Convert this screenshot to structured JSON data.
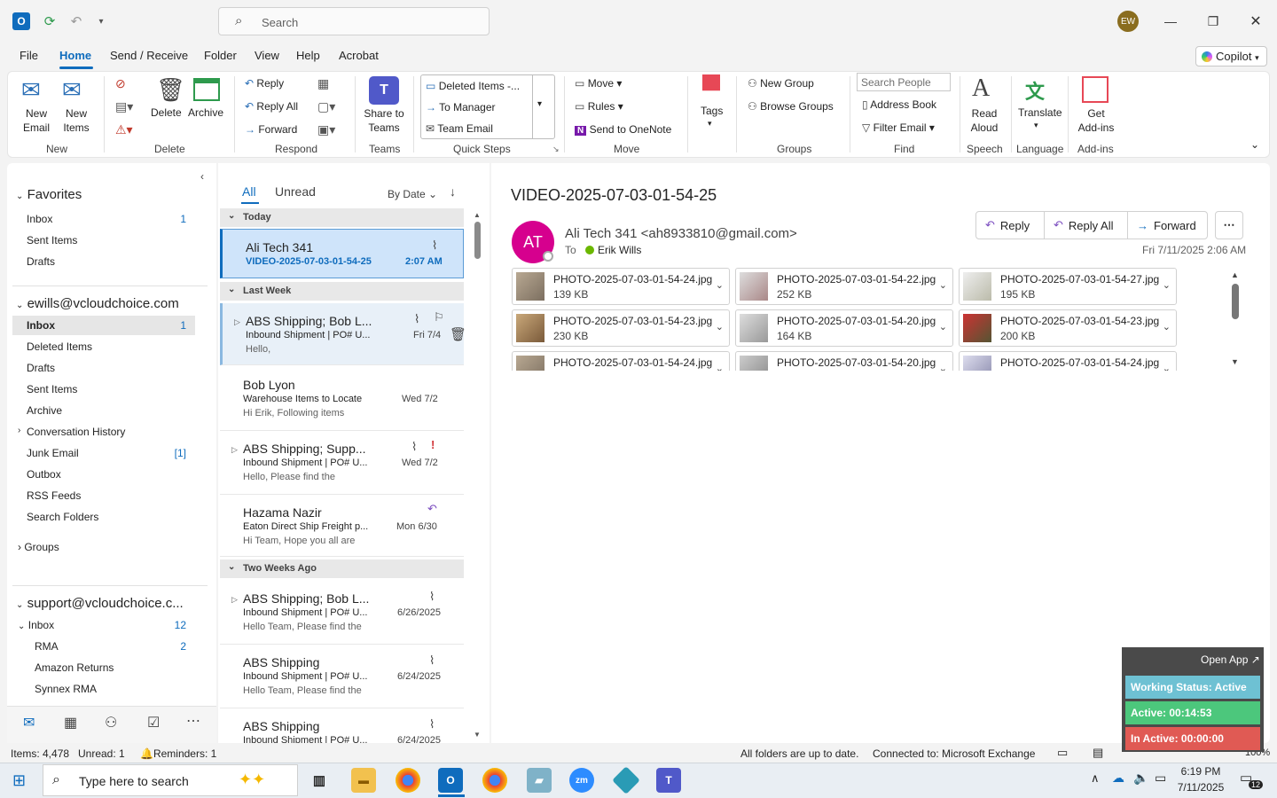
{
  "titlebar": {
    "search_placeholder": "Search",
    "avatar_initials": "EW"
  },
  "menu": [
    "File",
    "Home",
    "Send / Receive",
    "Folder",
    "View",
    "Help",
    "Acrobat"
  ],
  "copilot_label": "Copilot",
  "ribbon": {
    "new_email": "New Email",
    "new_items": "New Items",
    "group_new": "New",
    "delete": "Delete",
    "archive": "Archive",
    "group_delete": "Delete",
    "reply": "Reply",
    "reply_all": "Reply All",
    "forward": "Forward",
    "group_respond": "Respond",
    "share_to_teams": "Share to Teams",
    "group_teams": "Teams",
    "qs_deleted": "Deleted Items -...",
    "qs_manager": "To Manager",
    "qs_team_email": "Team Email",
    "group_quicksteps": "Quick Steps",
    "move": "Move",
    "rules": "Rules",
    "send_onenote": "Send to OneNote",
    "group_move": "Move",
    "tags": "Tags",
    "new_group": "New Group",
    "browse_groups": "Browse Groups",
    "group_groups": "Groups",
    "search_people": "Search People",
    "address_book": "Address Book",
    "filter_email": "Filter Email",
    "group_find": "Find",
    "read_aloud": "Read Aloud",
    "group_speech": "Speech",
    "translate": "Translate",
    "group_language": "Language",
    "get_addins": "Get Add-ins",
    "group_addins": "Add-ins"
  },
  "nav": {
    "favorites": "Favorites",
    "fav_items": [
      {
        "label": "Inbox",
        "count": "1"
      },
      {
        "label": "Sent Items",
        "count": ""
      },
      {
        "label": "Drafts",
        "count": ""
      }
    ],
    "account1": "ewills@vcloudchoice.com",
    "acc1_items": [
      {
        "label": "Inbox",
        "count": "1"
      },
      {
        "label": "Deleted Items",
        "count": ""
      },
      {
        "label": "Drafts",
        "count": ""
      },
      {
        "label": "Sent Items",
        "count": ""
      },
      {
        "label": "Archive",
        "count": ""
      },
      {
        "label": "Conversation History",
        "count": ""
      },
      {
        "label": "Junk Email",
        "count": "[1]"
      },
      {
        "label": "Outbox",
        "count": ""
      },
      {
        "label": "RSS Feeds",
        "count": ""
      },
      {
        "label": "Search Folders",
        "count": ""
      }
    ],
    "groups": "Groups",
    "account2": "support@vcloudchoice.c...",
    "acc2_items": [
      {
        "label": "Inbox",
        "count": "12"
      },
      {
        "label": "RMA",
        "count": "2"
      },
      {
        "label": "Amazon Returns",
        "count": ""
      },
      {
        "label": "Synnex RMA",
        "count": ""
      }
    ]
  },
  "list": {
    "tab_all": "All",
    "tab_unread": "Unread",
    "sort": "By Date",
    "groups": {
      "today": "Today",
      "last_week": "Last Week",
      "two_weeks": "Two Weeks Ago"
    },
    "messages": [
      {
        "sender": "Ali Tech 341",
        "subject": "VIDEO-2025-07-03-01-54-25",
        "preview": "",
        "date": "2:07 AM"
      },
      {
        "sender": "ABS Shipping;  Bob L...",
        "subject": "Inbound Shipment | PO# U...",
        "preview": "Hello,",
        "date": "Fri 7/4"
      },
      {
        "sender": "Bob Lyon",
        "subject": "Warehouse Items to Locate",
        "preview": "Hi Erik,  Following items",
        "date": "Wed 7/2"
      },
      {
        "sender": "ABS Shipping;  Supp...",
        "subject": "Inbound Shipment | PO# U...",
        "preview": "Hello,  Please find the",
        "date": "Wed 7/2"
      },
      {
        "sender": "Hazama Nazir",
        "subject": "Eaton Direct Ship Freight p...",
        "preview": "Hi Team,  Hope you all are",
        "date": "Mon 6/30"
      },
      {
        "sender": "ABS Shipping;  Bob L...",
        "subject": "Inbound Shipment | PO# U...",
        "preview": "Hello Team,  Please find the",
        "date": "6/26/2025"
      },
      {
        "sender": "ABS Shipping",
        "subject": "Inbound Shipment | PO# U...",
        "preview": "Hello Team,  Please find the",
        "date": "6/24/2025"
      },
      {
        "sender": "ABS Shipping",
        "subject": "Inbound Shipment | PO# U...",
        "preview": "",
        "date": "6/24/2025"
      }
    ]
  },
  "reading": {
    "subject": "VIDEO-2025-07-03-01-54-25",
    "avatar": "AT",
    "from": "Ali Tech 341 <ah8933810@gmail.com>",
    "to_label": "To",
    "to_name": "Erik Wills",
    "date": "Fri 7/11/2025 2:06 AM",
    "reply": "Reply",
    "reply_all": "Reply All",
    "forward": "Forward",
    "attachments": [
      {
        "name": "PHOTO-2025-07-03-01-54-24.jpg",
        "size": "139 KB"
      },
      {
        "name": "PHOTO-2025-07-03-01-54-22.jpg",
        "size": "252 KB"
      },
      {
        "name": "PHOTO-2025-07-03-01-54-27.jpg",
        "size": "195 KB"
      },
      {
        "name": "PHOTO-2025-07-03-01-54-23.jpg",
        "size": "230 KB"
      },
      {
        "name": "PHOTO-2025-07-03-01-54-20.jpg",
        "size": "164 KB"
      },
      {
        "name": "PHOTO-2025-07-03-01-54-23.jpg",
        "size": "200 KB"
      },
      {
        "name": "PHOTO-2025-07-03-01-54-24.jpg",
        "size": ""
      },
      {
        "name": "PHOTO-2025-07-03-01-54-20.jpg",
        "size": ""
      },
      {
        "name": "PHOTO-2025-07-03-01-54-24.jpg",
        "size": ""
      }
    ]
  },
  "status": {
    "items": "Items: 4,478",
    "unread": "Unread: 1",
    "reminders": "Reminders: 1",
    "uptodate": "All folders are up to date.",
    "connected": "Connected to: Microsoft Exchange",
    "zoom": "100%"
  },
  "widget": {
    "open_app": "Open App ↗",
    "working": "Working Status: Active",
    "active": "Active: 00:14:53",
    "inactive": "In Active: 00:00:00"
  },
  "taskbar": {
    "search": "Type here to search",
    "time": "6:19 PM",
    "date": "7/11/2025",
    "notif": "12"
  }
}
